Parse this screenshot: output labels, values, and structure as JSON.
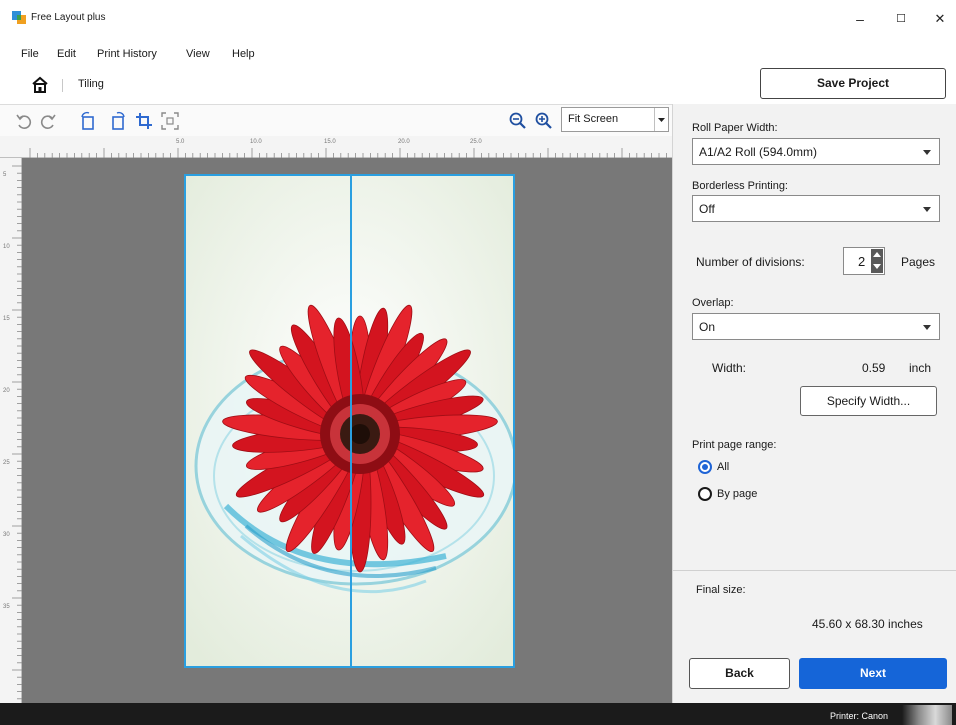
{
  "window": {
    "title": "Free Layout plus",
    "controls": {
      "minimize": "–",
      "maximize": "☐",
      "close": "✕"
    }
  },
  "menu": [
    "File",
    "Edit",
    "Print History",
    "View",
    "Help"
  ],
  "breadcrumb": {
    "current": "Tiling"
  },
  "toolbar": {
    "save_project": "Save Project",
    "icons": [
      "undo-icon",
      "redo-icon",
      "rotate-left-icon",
      "rotate-right-icon",
      "crop-icon",
      "fit-page-icon",
      "zoom-out-icon",
      "zoom-in-icon"
    ],
    "zoom_value": "Fit Screen"
  },
  "ruler": {
    "h_labels": [
      "5.0",
      "10.0",
      "15.0",
      "20.0",
      "25.0"
    ],
    "v_labels": [
      "5",
      "10",
      "15",
      "20",
      "25",
      "30",
      "35"
    ]
  },
  "panel": {
    "roll_paper_width_label": "Roll Paper Width:",
    "roll_paper_width_value": "A1/A2 Roll (594.0mm)",
    "borderless_label": "Borderless Printing:",
    "borderless_value": "Off",
    "divisions_label": "Number of divisions:",
    "divisions_value": "2",
    "divisions_unit": "Pages",
    "overlap_label": "Overlap:",
    "overlap_value": "On",
    "width_label": "Width:",
    "width_value": "0.59",
    "width_unit": "inch",
    "specify_width": "Specify Width...",
    "print_range_label": "Print page range:",
    "range_all": "All",
    "range_by_page": "By page",
    "final_size_label": "Final size:",
    "final_size_value": "45.60 x 68.30 inches",
    "back": "Back",
    "next": "Next"
  },
  "status": {
    "printer": "Printer: Canon"
  },
  "colors": {
    "accent": "#1565d8",
    "page_border": "#2a9fe0",
    "canvas": "#787878"
  }
}
